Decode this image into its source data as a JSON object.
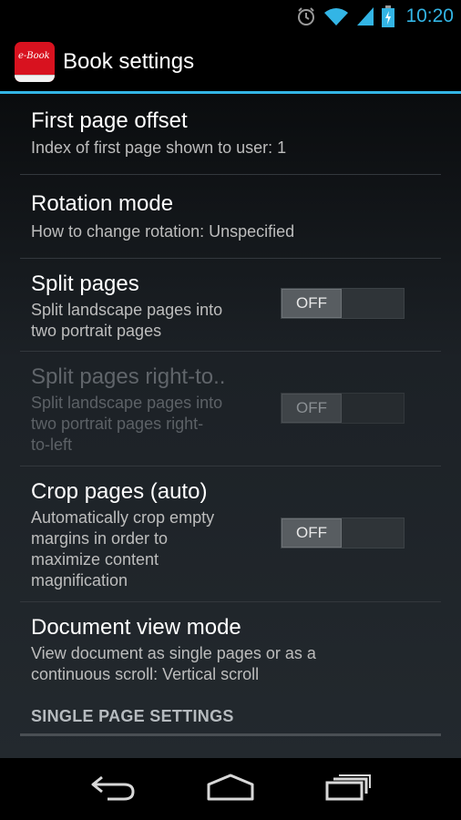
{
  "status_bar": {
    "time": "10:20",
    "icons": [
      "alarm-icon",
      "wifi-icon",
      "signal-icon",
      "battery-charging-icon"
    ],
    "accent_color": "#33b5e5"
  },
  "action_bar": {
    "app_icon_text": "e-Book",
    "title": "Book settings"
  },
  "preferences": [
    {
      "title": "First page offset",
      "summary": "Index of first page shown to user: 1",
      "enabled": true
    },
    {
      "title": "Rotation mode",
      "summary": "How to change rotation: Unspecified",
      "enabled": true
    },
    {
      "title": "Split pages",
      "summary_lines": [
        "Split landscape pages into",
        "two portrait pages"
      ],
      "toggle": "OFF",
      "enabled": true
    },
    {
      "title": "Split pages right-to..",
      "summary_lines": [
        "Split landscape pages into",
        "two portrait pages right-",
        "to-left"
      ],
      "toggle": "OFF",
      "enabled": false
    },
    {
      "title": "Crop pages (auto)",
      "summary_lines": [
        "Automatically crop empty",
        "margins in order to",
        "maximize content",
        "magnification"
      ],
      "toggle": "OFF",
      "enabled": true
    },
    {
      "title": "Document view mode",
      "summary_lines": [
        "View document as single pages or as a",
        "continuous scroll: Vertical scroll"
      ],
      "enabled": true
    }
  ],
  "section_header": "SINGLE PAGE SETTINGS",
  "nav_bar": {
    "buttons": [
      "back-icon",
      "home-icon",
      "recent-apps-icon"
    ]
  }
}
